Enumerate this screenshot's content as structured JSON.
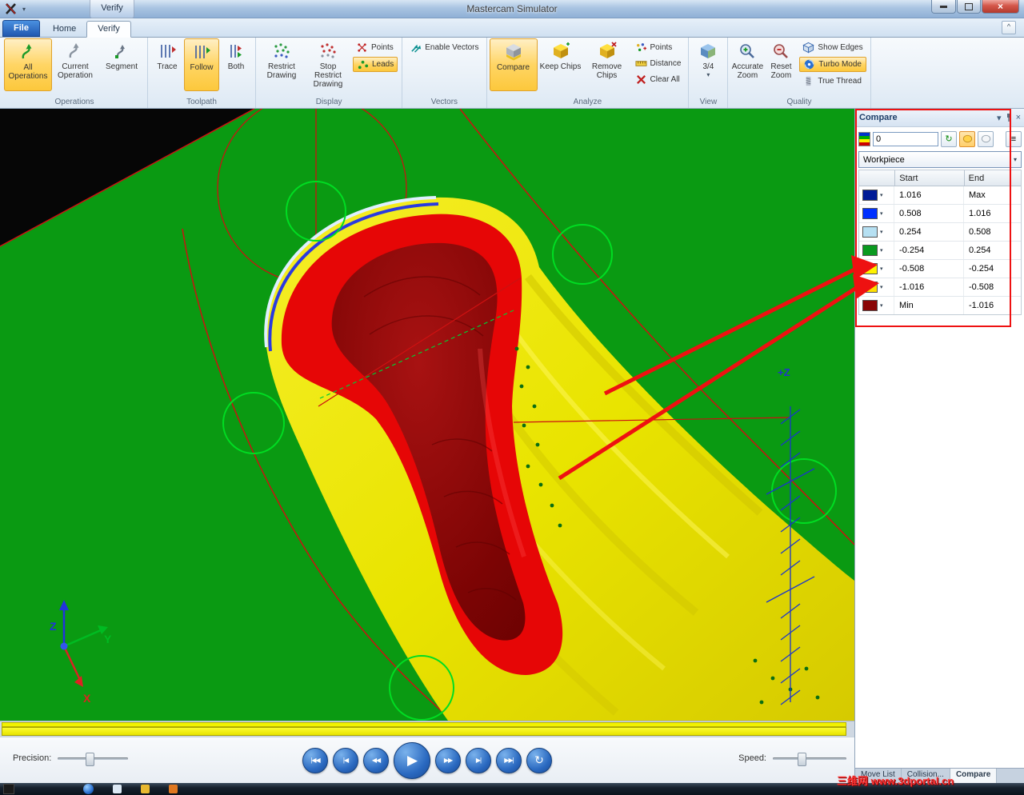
{
  "titlebar": {
    "title": "Mastercam Simulator",
    "contextual_group": "Verify"
  },
  "tabs": {
    "file": "File",
    "home": "Home",
    "verify": "Verify"
  },
  "glyphs": {
    "dropdown": "▾",
    "close": "×",
    "chevron_up": "^",
    "menu_lines": "≡",
    "refresh": "↻"
  },
  "ribbon": {
    "operations": {
      "label": "Operations",
      "all": "All Operations",
      "current": "Current Operation",
      "segment": "Segment"
    },
    "toolpath": {
      "label": "Toolpath",
      "trace": "Trace",
      "follow": "Follow",
      "both": "Both"
    },
    "display": {
      "label": "Display",
      "restrict": "Restrict Drawing",
      "stop_restrict": "Stop Restrict Drawing",
      "points": "Points",
      "leads": "Leads"
    },
    "vectors": {
      "label": "Vectors",
      "enable": "Enable Vectors"
    },
    "analyze": {
      "label": "Analyze",
      "compare": "Compare",
      "keep": "Keep Chips",
      "remove": "Remove Chips",
      "points": "Points",
      "distance": "Distance",
      "clear": "Clear All"
    },
    "view": {
      "label": "View",
      "three_quarter": "3/4"
    },
    "quality": {
      "label": "Quality",
      "accurate": "Accurate Zoom",
      "reset": "Reset Zoom",
      "show_edges": "Show Edges",
      "turbo": "Turbo Mode",
      "true_thread": "True Thread"
    }
  },
  "viewport": {
    "plus_z": "+Z",
    "axis_x": "X",
    "axis_y": "Y",
    "axis_z": "Z"
  },
  "compare_panel": {
    "title": "Compare",
    "tolerance_value": "0",
    "source": "Workpiece",
    "headers": {
      "start": "Start",
      "end": "End"
    },
    "rows": [
      {
        "color": "#001a96",
        "start": "1.016",
        "end": "Max"
      },
      {
        "color": "#0030ff",
        "start": "0.508",
        "end": "1.016"
      },
      {
        "color": "#b6e0f2",
        "start": "0.254",
        "end": "0.508"
      },
      {
        "color": "#0a9a20",
        "start": "-0.254",
        "end": "0.254"
      },
      {
        "color": "#fef200",
        "start": "-0.508",
        "end": "-0.254"
      },
      {
        "color": "#ffdf00",
        "start": "-1.016",
        "end": "-0.508"
      },
      {
        "color": "#8a0606",
        "start": "Min",
        "end": "-1.016"
      }
    ]
  },
  "playback": {
    "precision_label": "Precision:",
    "speed_label": "Speed:",
    "buttons": [
      {
        "name": "skip-to-start",
        "glyph": "|◀◀"
      },
      {
        "name": "step-back",
        "glyph": "|◀"
      },
      {
        "name": "rewind",
        "glyph": "◀◀"
      },
      {
        "name": "play",
        "glyph": "▶"
      },
      {
        "name": "fast-forward",
        "glyph": "▶▶"
      },
      {
        "name": "step-forward",
        "glyph": "▶|"
      },
      {
        "name": "skip-to-end",
        "glyph": "▶▶|"
      },
      {
        "name": "loop",
        "glyph": "↻"
      }
    ]
  },
  "status_tabs": {
    "move_list": "Move List",
    "collision": "Collision...",
    "compare": "Compare"
  },
  "watermark": "三维网 www.3dportal.cn",
  "colors": {
    "highlight": "#FFD564",
    "viewport_green": "#0A9A12",
    "stock_yellow": "#EDE800",
    "overcut_red": "#E60606",
    "deep_maroon": "#7C0404",
    "annotation_red": "#EE1111"
  }
}
